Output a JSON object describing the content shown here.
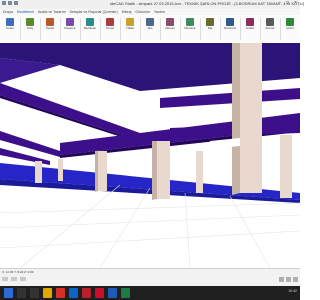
{
  "window": {
    "title": "ideCAD Statik - simpark 27.03.2015.icm - TEKNİK ŞARLON PROJE - [3.BODRUM KAT TAVANI - 4.Kt KOTU]",
    "min_glyph": "–",
    "max_glyph": "□",
    "close_glyph": "×"
  },
  "tabs": [
    "Dosya",
    "Modelleme",
    "Analiz ve Tasarım",
    "Detaylar ve Raporlar (Çizimler)",
    "Metraj",
    "Görünüm",
    "Yardım"
  ],
  "ribbon": {
    "groups": [
      {
        "label": "Kolon",
        "icon": "column-icon"
      },
      {
        "label": "Kiriş",
        "icon": "beam-icon"
      },
      {
        "label": "Perde",
        "icon": "wall-icon"
      },
      {
        "label": "Döşeme",
        "icon": "slab-icon"
      },
      {
        "label": "Merdiven",
        "icon": "stairs-icon"
      },
      {
        "label": "Temel",
        "icon": "foundation-icon"
      },
      {
        "label": "Yükler",
        "icon": "load-icon"
      },
      {
        "label": "Aks",
        "icon": "axis-icon"
      },
      {
        "label": "Mimari",
        "icon": "architecture-icon"
      },
      {
        "label": "Düzenle",
        "icon": "edit-icon"
      },
      {
        "label": "Kat",
        "icon": "floor-icon"
      },
      {
        "label": "Görünüm",
        "icon": "view-icon"
      },
      {
        "label": "Analiz",
        "icon": "analysis-icon"
      },
      {
        "label": "Donatı",
        "icon": "rebar-icon"
      },
      {
        "label": "Çizim",
        "icon": "drawing-icon"
      }
    ]
  },
  "statusbar": {
    "coord": "X: 12.45  Y: 8.20  Z: 0.00"
  },
  "taskbar": {
    "time": "10:42",
    "items": [
      {
        "icon": "windows-start-icon",
        "color": "#2b6cd6"
      },
      {
        "icon": "search-icon",
        "color": "#333"
      },
      {
        "icon": "task-view-icon",
        "color": "#333"
      },
      {
        "icon": "file-explorer-icon",
        "color": "#e0a800"
      },
      {
        "icon": "chrome-icon",
        "color": "#d93025"
      },
      {
        "icon": "outlook-icon",
        "color": "#0a64c9"
      },
      {
        "icon": "pdf-icon",
        "color": "#b8202a"
      },
      {
        "icon": "autocad-icon",
        "color": "#c8102e"
      },
      {
        "icon": "idecad-icon",
        "color": "#1c5bb8"
      },
      {
        "icon": "excel-icon",
        "color": "#1e7a45"
      }
    ]
  },
  "colors": {
    "beam": "#3d0f8a",
    "beam_dark": "#23065a",
    "column": "#e8d8ce",
    "column_shadow": "#c7b3a6",
    "slab_underside": "#2b1377",
    "floor": "#f4f4f4",
    "floor_strip": "#2626c8"
  }
}
